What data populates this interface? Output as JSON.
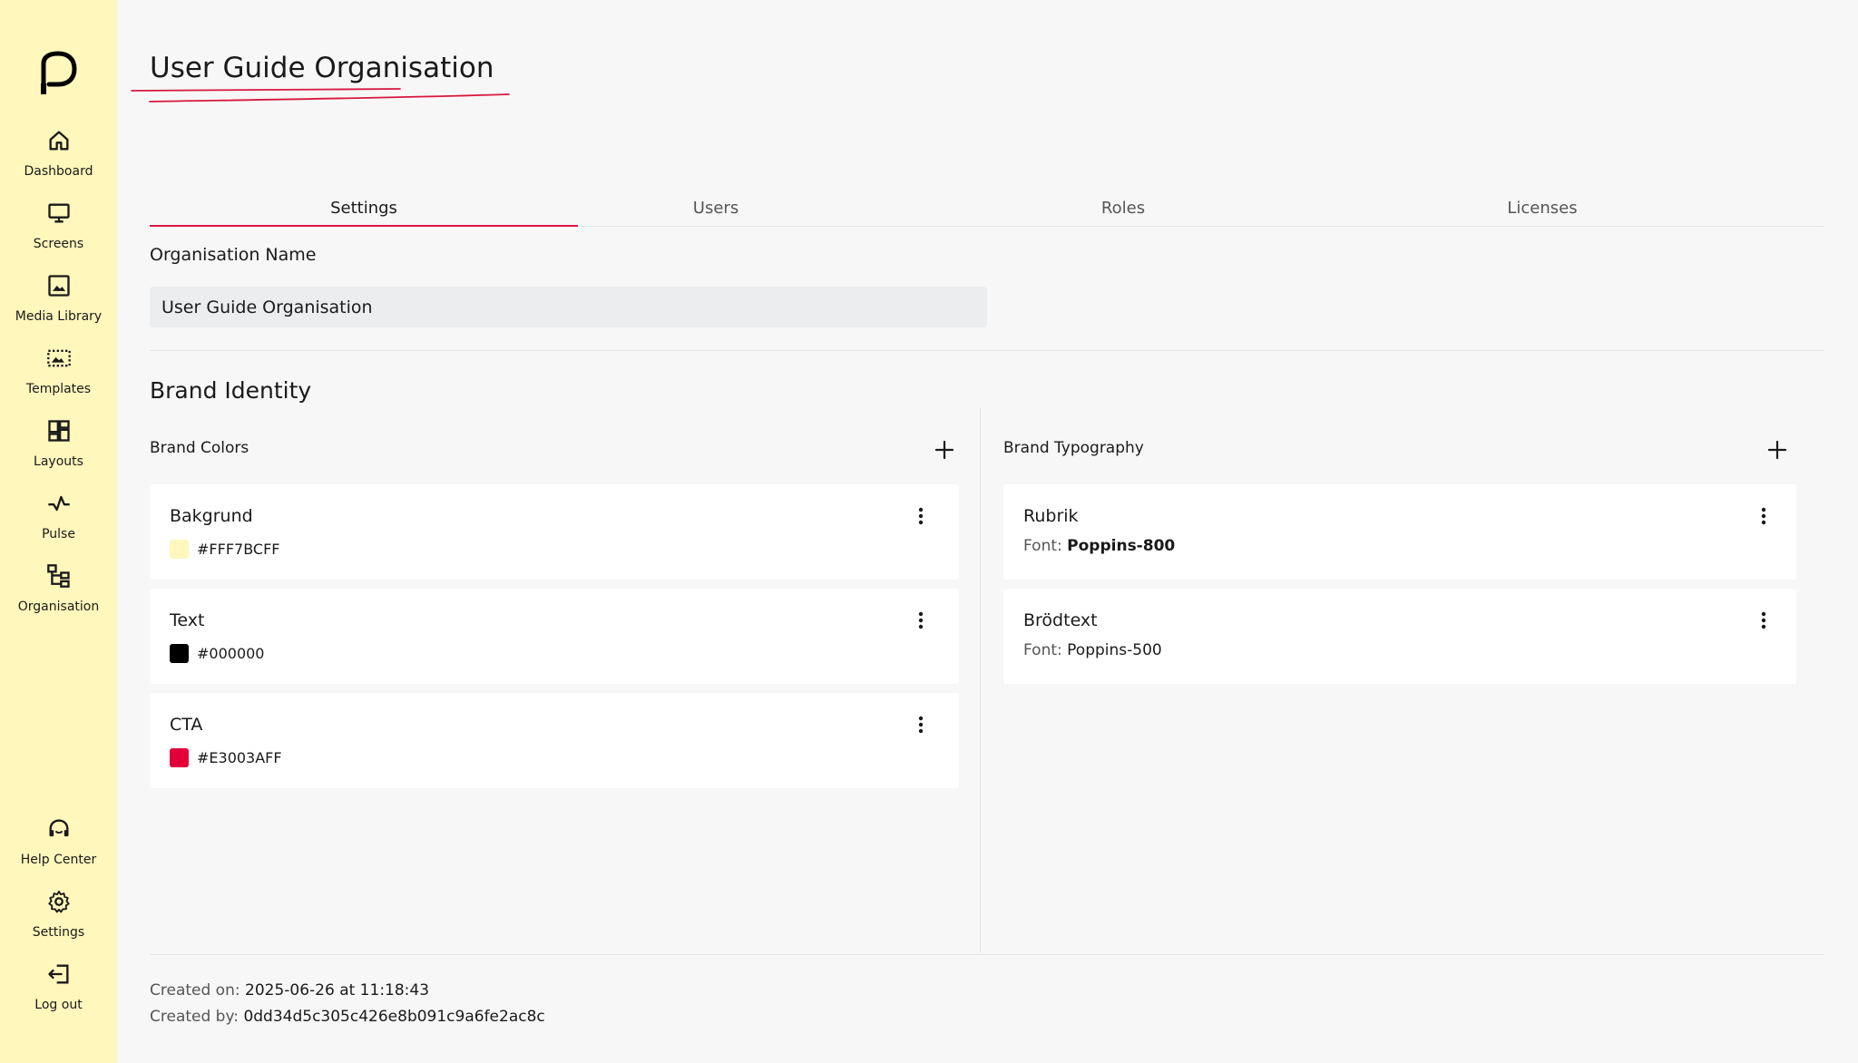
{
  "sidebar": {
    "items": [
      {
        "label": "Dashboard",
        "icon": "home-icon"
      },
      {
        "label": "Screens",
        "icon": "monitor-icon"
      },
      {
        "label": "Media Library",
        "icon": "image-icon"
      },
      {
        "label": "Templates",
        "icon": "template-icon"
      },
      {
        "label": "Layouts",
        "icon": "layout-icon"
      },
      {
        "label": "Pulse",
        "icon": "pulse-icon"
      },
      {
        "label": "Organisation",
        "icon": "organisation-icon"
      }
    ],
    "bottom_items": [
      {
        "label": "Help Center",
        "icon": "headset-icon"
      },
      {
        "label": "Settings",
        "icon": "gear-icon"
      },
      {
        "label": "Log out",
        "icon": "logout-icon"
      }
    ],
    "background": "#FFF7BC"
  },
  "page": {
    "title": "User Guide Organisation"
  },
  "tabs": [
    {
      "label": "Settings",
      "active": true
    },
    {
      "label": "Users",
      "active": false
    },
    {
      "label": "Roles",
      "active": false
    },
    {
      "label": "Licenses",
      "active": false
    }
  ],
  "settings": {
    "name_label": "Organisation Name",
    "name_value": "User Guide Organisation"
  },
  "brand": {
    "title": "Brand Identity",
    "colors_title": "Brand Colors",
    "typography_title": "Brand Typography",
    "colors": [
      {
        "name": "Bakgrund",
        "hex": "#FFF7BCFF",
        "swatch": "#FFF7BC"
      },
      {
        "name": "Text",
        "hex": "#000000",
        "swatch": "#000000"
      },
      {
        "name": "CTA",
        "hex": "#E3003AFF",
        "swatch": "#E3003A"
      }
    ],
    "typography": [
      {
        "name": "Rubrik",
        "font_label": "Font:",
        "font": "Poppins-800"
      },
      {
        "name": "Brödtext",
        "font_label": "Font:",
        "font": "Poppins-500"
      }
    ]
  },
  "meta": {
    "created_on_label": "Created on:",
    "created_on": "2025-06-26 at 11:18:43",
    "created_by_label": "Created by:",
    "created_by": "0dd34d5c305c426e8b091c9a6fe2ac8c"
  },
  "accent": "#D8173E"
}
